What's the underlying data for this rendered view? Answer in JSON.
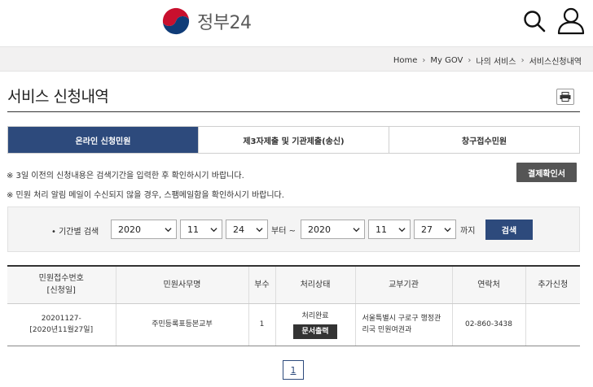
{
  "header": {
    "logo_text": "정부24"
  },
  "breadcrumb": [
    "Home",
    "My GOV",
    "나의 서비스",
    "서비스신청내역"
  ],
  "page": {
    "title": "서비스 신청내역"
  },
  "tabs": [
    {
      "label": "온라인 신청민원",
      "active": true
    },
    {
      "label": "제3자제출 및 기관제출(송신)",
      "active": false
    },
    {
      "label": "창구접수민원",
      "active": false
    }
  ],
  "notices": {
    "line1": "※ 3일 이전의 신청내용은 검색기간을 입력한 후 확인하시기 바랍니다.",
    "line2": "※ 민원 처리 알림 메일이 수신되지 않을 경우, 스팸메일함을 확인하시기 바랍니다.",
    "pay_button": "결제확인서"
  },
  "search": {
    "label": "• 기간별 검색",
    "from_year": "2020",
    "from_month": "11",
    "from_day": "24",
    "from_text": "부터 ~",
    "to_year": "2020",
    "to_month": "11",
    "to_day": "27",
    "to_text": "까지",
    "button": "검색"
  },
  "table": {
    "headers": [
      "민원접수번호",
      "[신청일]",
      "민원사무명",
      "부수",
      "처리상태",
      "교부기관",
      "연락처",
      "추가신청"
    ],
    "rows": [
      {
        "receipt_no": "20201127-",
        "apply_date": "[2020년11월27일]",
        "service": "주민등록표등본교부",
        "copies": "1",
        "status": "처리완료",
        "doc_button": "문서출력",
        "org_line1": "서울특별시 구로구 행정관",
        "org_line2": "리국 민원여권과",
        "contact": "02-860-3438",
        "additional": ""
      }
    ]
  },
  "pagination": {
    "current": "1"
  },
  "colors": {
    "primary": "#2d4a7c",
    "dark_button": "#555555"
  }
}
